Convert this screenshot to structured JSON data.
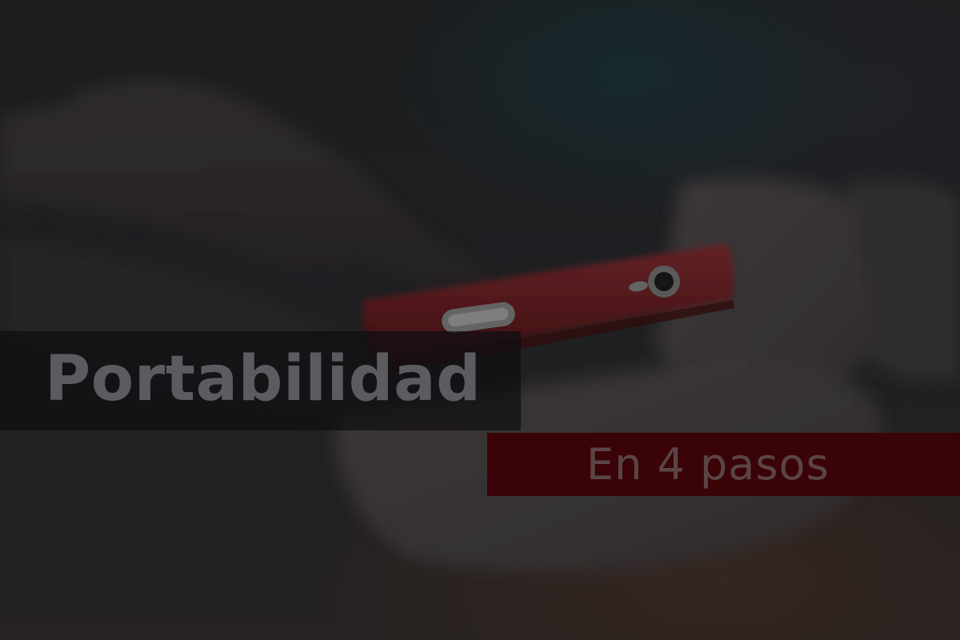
{
  "banner": {
    "title": "Portabilidad",
    "subtitle": "En 4 pasos"
  },
  "photo": {
    "subject": "phone-in-hands",
    "colors": {
      "phone_case": "#6a1e22",
      "overlay_dark": "#0e0e10",
      "subtitle_band": "#3a0308",
      "title_text": "#5c5c60",
      "subtitle_text": "#5a4546"
    }
  }
}
